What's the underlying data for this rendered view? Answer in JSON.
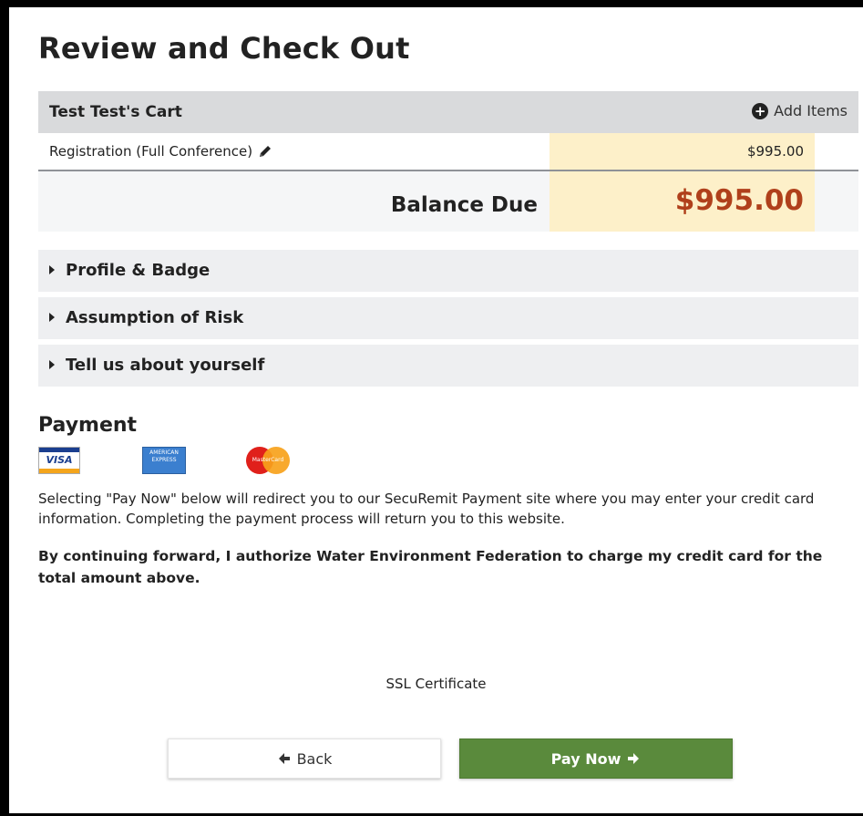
{
  "page": {
    "title": "Review and Check Out"
  },
  "cart": {
    "title": "Test Test's Cart",
    "add_items_label": "Add Items",
    "line_items": [
      {
        "label": "Registration (Full Conference)",
        "amount": "$995.00"
      }
    ],
    "balance_label": "Balance Due",
    "balance_amount": "$995.00"
  },
  "accordions": [
    {
      "label": "Profile & Badge"
    },
    {
      "label": "Assumption of Risk"
    },
    {
      "label": "Tell us about yourself"
    }
  ],
  "payment": {
    "title": "Payment",
    "card_logos": {
      "visa": "VISA",
      "amex": "AMERICAN EXPRESS",
      "mastercard": "MasterCard"
    },
    "instructions": "Selecting \"Pay Now\" below will redirect you to our SecuRemit Payment site where you may enter your credit card information. Completing the payment process will return you to this website.",
    "authorization": "By continuing forward, I authorize Water Environment Federation to charge my credit card for the total amount above.",
    "ssl_label": "SSL Certificate"
  },
  "buttons": {
    "back_label": "Back",
    "pay_label": "Pay Now"
  },
  "colors": {
    "accent_green": "#5a8a3c",
    "balance_red": "#b0401b",
    "highlight": "#fdf0c9"
  }
}
